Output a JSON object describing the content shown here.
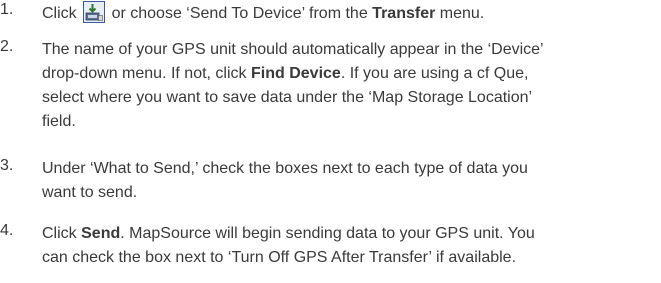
{
  "steps": [
    {
      "number": "1.",
      "before_icon": "Click",
      "icon": "send-to-device-icon",
      "after_icon": "or choose ‘Send To Device’ from the",
      "bold": "Transfer",
      "tail": "menu."
    },
    {
      "number": "2.",
      "line1": "The name of your GPS unit should automatically appear in the ‘Device’",
      "line2_before": "drop-down menu. If not, click",
      "line2_bold": "Find Device",
      "line2_after": ". If you are using a cf Que,",
      "line3": "select where you want to save data under the ‘Map Storage Location’",
      "line4": "field."
    },
    {
      "number": "3.",
      "line1": "Under ‘What to Send,’ check the boxes next to each type of data you",
      "line2": "want to send."
    },
    {
      "number": "4.",
      "line1_before": "Click",
      "line1_bold": "Send",
      "line1_after": ". MapSource will begin sending data to your GPS unit. You",
      "line2": "can check the box next to ‘Turn Off GPS After Transfer’ if available."
    }
  ],
  "colors": {
    "text": "#3a3a3a",
    "icon_frame": "#3c5a9a",
    "icon_fill": "#e8eef8"
  }
}
